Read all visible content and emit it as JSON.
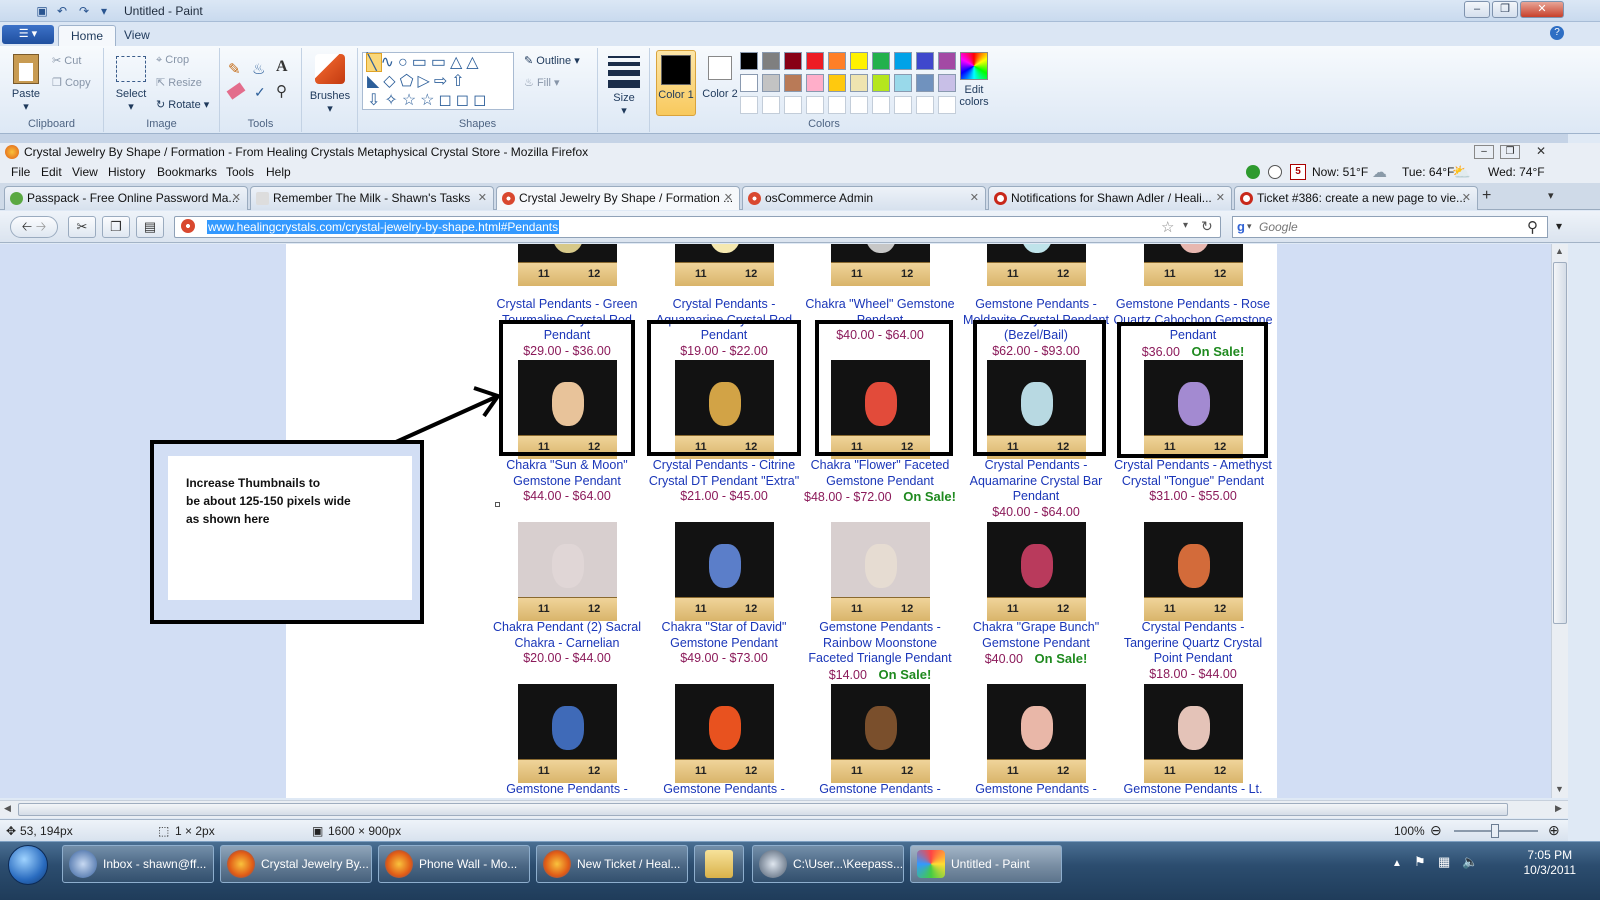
{
  "paint": {
    "title": "Untitled - Paint",
    "tabs": [
      "Home",
      "View"
    ],
    "clipboard": {
      "paste": "Paste",
      "cut": "Cut",
      "copy": "Copy",
      "label": "Clipboard"
    },
    "image": {
      "select": "Select",
      "crop": "Crop",
      "resize": "Resize",
      "rotate": "Rotate",
      "label": "Image"
    },
    "tools": {
      "label": "Tools"
    },
    "brushes": "Brushes",
    "shapes": {
      "outline": "Outline",
      "fill": "Fill",
      "label": "Shapes"
    },
    "size": "Size",
    "color1": "Color 1",
    "color2": "Color 2",
    "edit_colors": "Edit colors",
    "colors_label": "Colors",
    "palette_row1": [
      "#000000",
      "#7f7f7f",
      "#880015",
      "#ed1c24",
      "#ff7f27",
      "#fff200",
      "#22b14c",
      "#00a2e8",
      "#3f48cc",
      "#a349a4"
    ],
    "palette_row2": [
      "#ffffff",
      "#c3c3c3",
      "#b97a57",
      "#ffaec9",
      "#ffc90e",
      "#efe4b0",
      "#b5e61d",
      "#99d9ea",
      "#7092be",
      "#c8bfe7"
    ],
    "status": {
      "cursor": "53, 194px",
      "selection": "1 × 2px",
      "canvas": "1600 × 900px",
      "zoom": "100%"
    }
  },
  "firefox": {
    "title": "Crystal Jewelry By Shape / Formation - From Healing Crystals Metaphysical Crystal Store - Mozilla Firefox",
    "menu": [
      "File",
      "Edit",
      "View",
      "History",
      "Bookmarks",
      "Tools",
      "Help"
    ],
    "weather": {
      "now": "Now: 51°F",
      "tue": "Tue: 64°F",
      "wed": "Wed: 74°F"
    },
    "tabs": [
      "Passpack - Free Online Password Ma...",
      "Remember The Milk - Shawn's Tasks",
      "Crystal Jewelry By Shape / Formation ...",
      "osCommerce Admin",
      "Notifications for Shawn Adler / Heali...",
      "Ticket #386: create a new page to vie..."
    ],
    "url": "www.healingcrystals.com/crystal-jewelry-by-shape.html#Pendants",
    "search_placeholder": "Google"
  },
  "annotation": {
    "line1": "Increase Thumbnails to",
    "line2": "be about 125-150 pixels wide",
    "line3": "as shown here"
  },
  "products": {
    "row0": [
      {
        "name": "Crystal Pendants - Green Tourmaline Crystal Rod Pendant",
        "price": "$29.00 - $36.00"
      },
      {
        "name": "Crystal Pendants - Aquamarine Crystal Rod Pendant",
        "price": "$19.00 - $22.00"
      },
      {
        "name": "Chakra \"Wheel\" Gemstone Pendant",
        "price": "$40.00 - $64.00"
      },
      {
        "name": "Gemstone Pendants - Moldavite Crystal Pendant (Bezel/Bail)",
        "price": "$62.00 - $93.00"
      },
      {
        "name": "Gemstone Pendants - Rose Quartz Cabochon Gemstone Pendant",
        "price": "$36.00",
        "sale": "On Sale!"
      }
    ],
    "row1": [
      {
        "name": "Chakra \"Sun & Moon\" Gemstone Pendant",
        "price": "$44.00 - $64.00"
      },
      {
        "name": "Crystal Pendants - Citrine Crystal DT Pendant \"Extra\"",
        "price": "$21.00 - $45.00"
      },
      {
        "name": "Chakra \"Flower\" Faceted Gemstone Pendant",
        "price": "$48.00 - $72.00",
        "sale": "On Sale!"
      },
      {
        "name": "Crystal Pendants - Aquamarine Crystal Bar Pendant",
        "price": "$40.00 - $64.00"
      },
      {
        "name": "Crystal Pendants - Amethyst Crystal \"Tongue\" Pendant",
        "price": "$31.00 - $55.00"
      }
    ],
    "row2": [
      {
        "name": "Chakra Pendant (2) Sacral Chakra - Carnelian",
        "price": "$20.00 - $44.00"
      },
      {
        "name": "Chakra \"Star of David\" Gemstone Pendant",
        "price": "$49.00 - $73.00"
      },
      {
        "name": "Gemstone Pendants - Rainbow Moonstone Faceted Triangle Pendant",
        "price": "$14.00",
        "sale": "On Sale!"
      },
      {
        "name": "Chakra \"Grape Bunch\" Gemstone Pendant",
        "price": "$40.00",
        "sale": "On Sale!"
      },
      {
        "name": "Crystal Pendants - Tangerine Quartz Crystal Point Pendant",
        "price": "$18.00 - $44.00"
      }
    ],
    "row3": [
      {
        "name": "Gemstone Pendants -"
      },
      {
        "name": "Gemstone Pendants -"
      },
      {
        "name": "Gemstone Pendants -"
      },
      {
        "name": "Gemstone Pendants -"
      },
      {
        "name": "Gemstone Pendants - Lt."
      }
    ]
  },
  "ruler": {
    "a": "11",
    "b": "12"
  },
  "taskbar": {
    "items": [
      "Inbox - shawn@ff...",
      "Crystal Jewelry By...",
      "Phone Wall - Mo...",
      "New Ticket / Heal...",
      "",
      "C:\\User...\\Keepass...",
      "Untitled - Paint"
    ],
    "time": "7:05 PM",
    "date": "10/3/2011"
  }
}
